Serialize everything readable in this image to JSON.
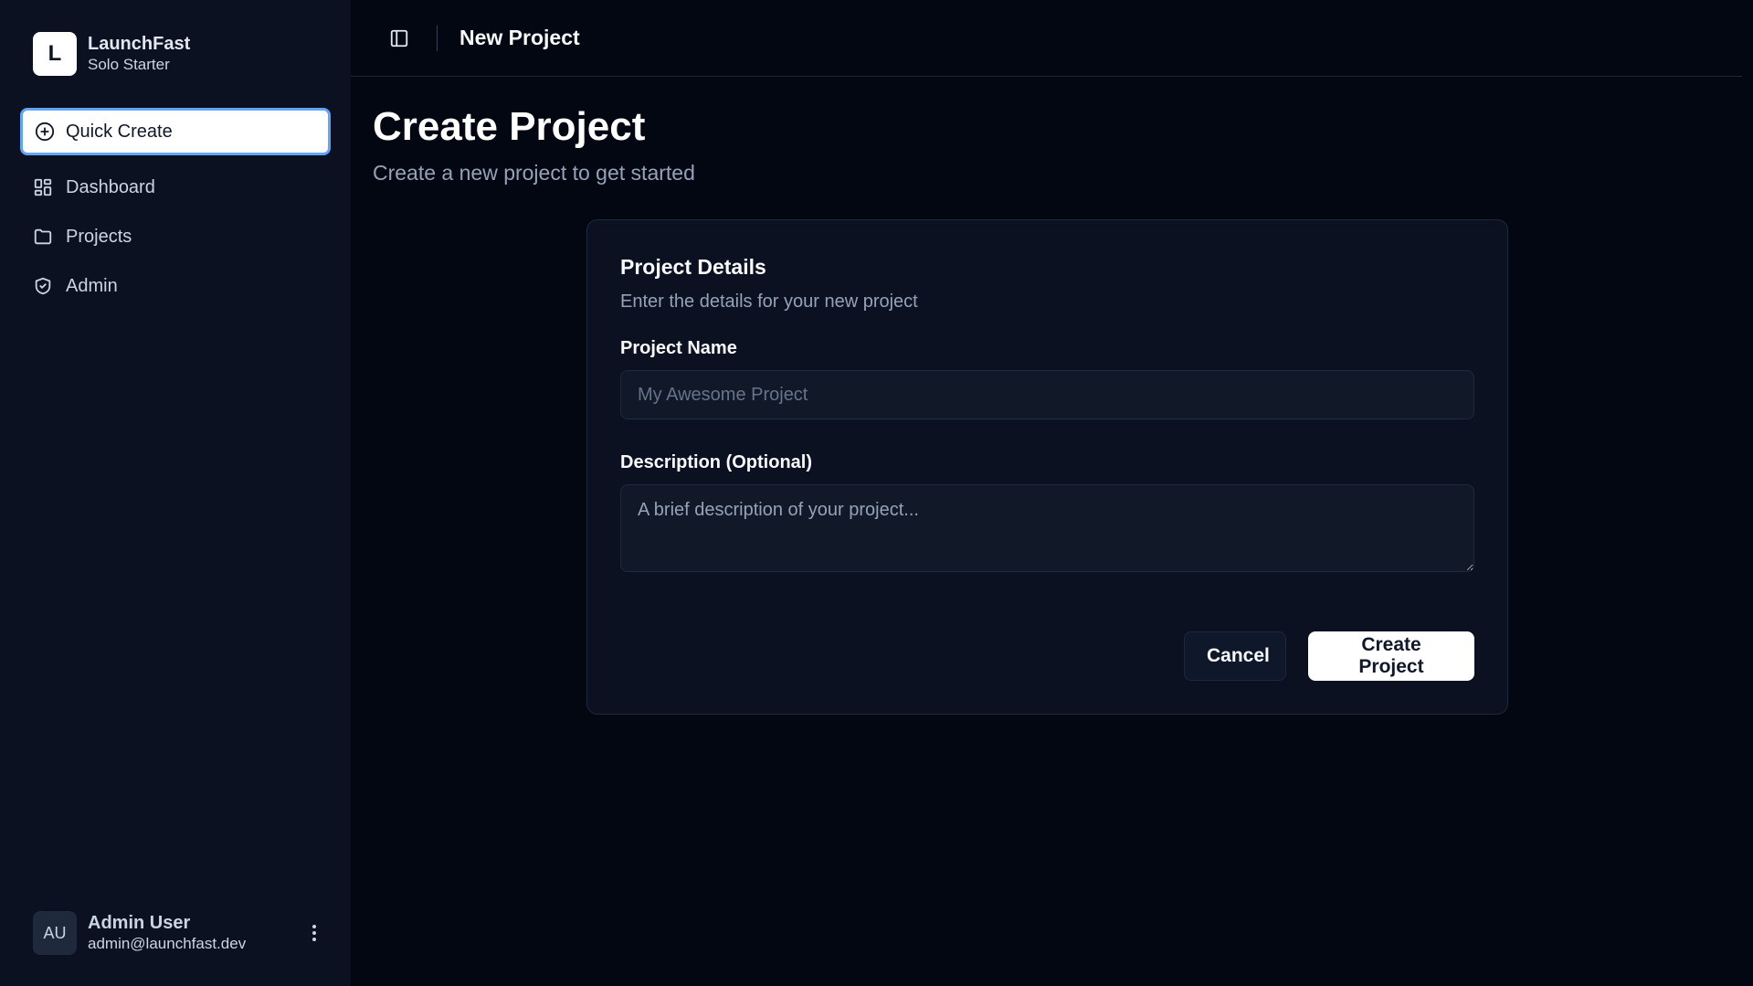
{
  "brand": {
    "logo_letter": "L",
    "name": "LaunchFast",
    "plan": "Solo Starter"
  },
  "sidebar": {
    "quick_create": {
      "label": "Quick Create",
      "icon": "plus-circle-icon"
    },
    "items": [
      {
        "label": "Dashboard",
        "icon": "dashboard-grid-icon"
      },
      {
        "label": "Projects",
        "icon": "folder-icon"
      },
      {
        "label": "Admin",
        "icon": "shield-icon"
      }
    ]
  },
  "user": {
    "initials": "AU",
    "name": "Admin User",
    "email": "admin@launchfast.dev"
  },
  "topbar": {
    "title": "New Project",
    "toggle_icon": "sidebar-toggle-icon"
  },
  "page": {
    "title": "Create Project",
    "subtitle": "Create a new project to get started"
  },
  "form": {
    "title": "Project Details",
    "description": "Enter the details for your new project",
    "name_label": "Project Name",
    "name_value": "",
    "name_placeholder": "My Awesome Project",
    "desc_label": "Description (Optional)",
    "desc_value": "",
    "desc_placeholder": "A brief description of your project...",
    "cancel_label": "Cancel",
    "submit_label": "Create Project"
  },
  "colors": {
    "background": "#030712",
    "sidebar": "#0b1120",
    "focus_ring": "#60a5fa",
    "primary_button": "#ffffff"
  }
}
